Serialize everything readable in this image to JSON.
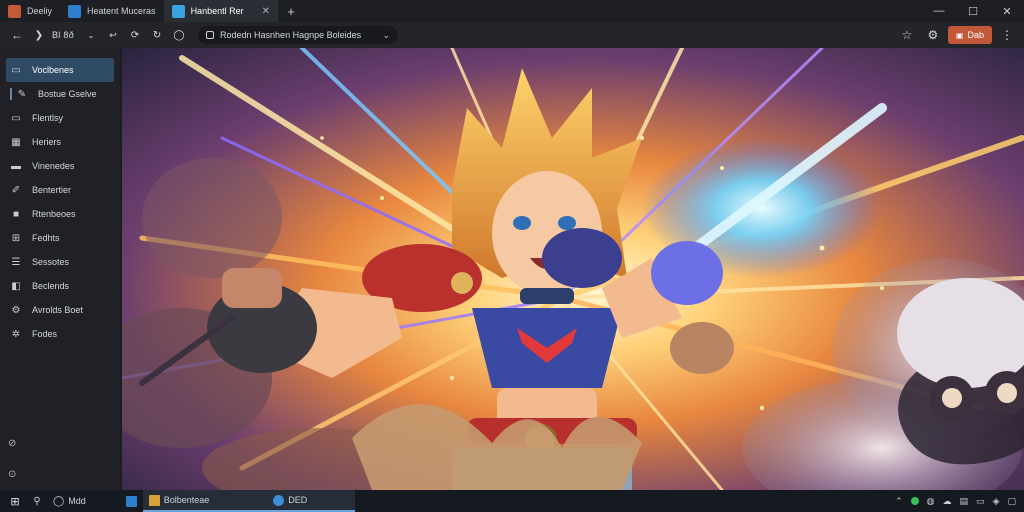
{
  "colors": {
    "accent": "#c2573a",
    "active_nav": "#2f4b63",
    "tab_icon_1": "#c45a3a",
    "tab_icon_2": "#2f7fd1",
    "tab_icon_3": "#3aa3e0",
    "status_green": "#3bbf5a"
  },
  "tabs": [
    {
      "label": "Deeliy",
      "icon": "app-logo-icon"
    },
    {
      "label": "Heatent Muceras",
      "icon": "document-icon"
    },
    {
      "label": "Hanbentl Rer",
      "icon": "document-icon",
      "active": true
    }
  ],
  "toolbar": {
    "nav_text": "Bl 8ð",
    "address": "Rodedn Hasnhen Hagnpe  Boleides",
    "accent_label": "Dab"
  },
  "sidebar": {
    "items": [
      {
        "label": "Voclbenes",
        "icon": "monitor-icon",
        "active": true
      },
      {
        "label": "Bostue Gselve",
        "icon": "edit-icon",
        "sub": true
      },
      {
        "label": "Flentlsy",
        "icon": "monitor-icon"
      },
      {
        "label": "Heriers",
        "icon": "grid-icon"
      },
      {
        "label": "Vinenedes",
        "icon": "folder-icon"
      },
      {
        "label": "Bentertier",
        "icon": "pen-icon"
      },
      {
        "label": "Rtenbeoes",
        "icon": "box-icon"
      },
      {
        "label": "Fedhts",
        "icon": "layout-icon"
      },
      {
        "label": "Sessotes",
        "icon": "list-icon"
      },
      {
        "label": "Beclends",
        "icon": "chart-icon"
      },
      {
        "label": "Avrolds Boet",
        "icon": "gear-icon"
      },
      {
        "label": "Fodes",
        "icon": "settings-icon"
      }
    ]
  },
  "taskbar": {
    "search_label": "Mdd",
    "app1_label": "Bolbenteae",
    "app2_label": "DED"
  }
}
